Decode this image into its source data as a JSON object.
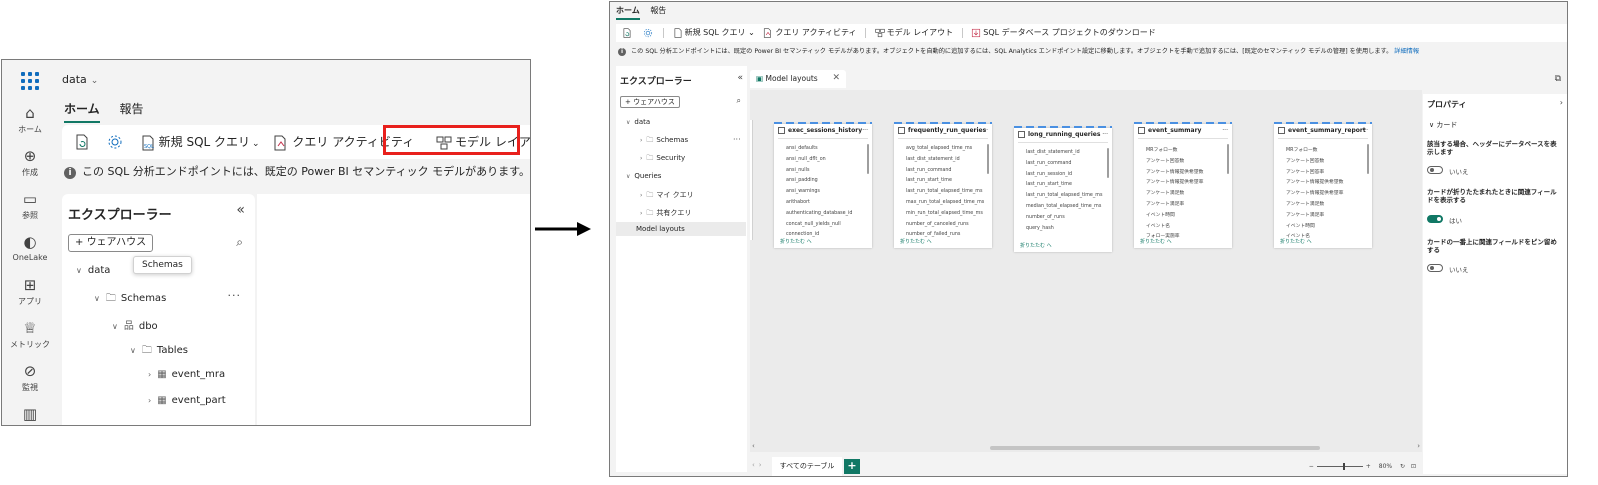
{
  "left": {
    "workspace_name": "data",
    "rail": [
      {
        "label": "ホーム",
        "icon": "home-icon"
      },
      {
        "label": "作成",
        "icon": "create-icon"
      },
      {
        "label": "参照",
        "icon": "browse-icon"
      },
      {
        "label": "OneLake",
        "icon": "onelake-icon"
      },
      {
        "label": "アプリ",
        "icon": "apps-icon"
      },
      {
        "label": "メトリック",
        "icon": "metrics-icon"
      },
      {
        "label": "監視",
        "icon": "monitor-icon"
      }
    ],
    "tabs": [
      "ホーム",
      "報告"
    ],
    "ribbon": {
      "new_sql_query": "新規 SQL クエリ",
      "query_activity": "クエリ アクティビティ",
      "model_layouts": "モデル レイアウト"
    },
    "info_text": "この SQL 分析エンドポイントには、既定の Power BI セマンティック モデルがあります。オブジェクトを自",
    "explorer": {
      "title": "エクスプローラー",
      "add_warehouse": "ウェアハウス",
      "tooltip": "Schemas",
      "tree": [
        {
          "label": "data",
          "level": 0,
          "caret": "down"
        },
        {
          "label": "Schemas",
          "level": 1,
          "caret": "down",
          "icon": "folder"
        },
        {
          "label": "dbo",
          "level": 2,
          "caret": "down",
          "icon": "schema"
        },
        {
          "label": "Tables",
          "level": 3,
          "caret": "down",
          "icon": "folder"
        },
        {
          "label": "event_mra",
          "level": 4,
          "caret": "right",
          "icon": "table"
        },
        {
          "label": "event_part",
          "level": 4,
          "caret": "right",
          "icon": "table"
        }
      ]
    }
  },
  "right": {
    "tabs": [
      "ホーム",
      "報告"
    ],
    "ribbon": {
      "new_sql_query": "新規 SQL クエリ",
      "query_activity": "クエリ アクティビティ",
      "model_layouts": "モデル レイアウト",
      "download": "SQL データベース プロジェクトのダウンロード"
    },
    "info_text": "この SQL 分析エンドポイントには、既定の Power BI セマンティック モデルがあります。オブジェクトを自動的に追加するには、SQL Analytics エンドポイント設定に移動します。オブジェクトを手動で追加するには、[既定のセマンティック モデルの管理] を使用します。",
    "info_link": "詳細情報",
    "explorer": {
      "title": "エクスプローラー",
      "add_warehouse": "ウェアハウス",
      "tree": [
        {
          "label": "data",
          "caret": "down"
        },
        {
          "label": "Schemas",
          "caret": "right",
          "icon": "folder"
        },
        {
          "label": "Security",
          "caret": "right",
          "icon": "folder"
        },
        {
          "label": "Queries",
          "caret": "down"
        },
        {
          "label": "マイ クエリ",
          "caret": "right",
          "icon": "folder"
        },
        {
          "label": "共有クエリ",
          "caret": "right",
          "icon": "folder"
        },
        {
          "label": "Model layouts",
          "selected": true
        }
      ]
    },
    "doc_tab": "Model layouts",
    "cards": [
      {
        "title": "exec_sessions_history",
        "fields": [
          "ansi_defaults",
          "ansi_null_dflt_on",
          "ansi_nulls",
          "ansi_padding",
          "ansi_warnings",
          "arithabort",
          "authenticating_database_id",
          "concat_null_yields_null",
          "connection_id"
        ],
        "footer": "折りたたむ へ"
      },
      {
        "title": "frequently_run_queries",
        "fields": [
          "avg_total_elapsed_time_ms",
          "last_dist_statement_id",
          "last_run_command",
          "last_run_start_time",
          "last_run_total_elapsed_time_ms",
          "max_run_total_elapsed_time_ms",
          "min_run_total_elapsed_time_ms",
          "number_of_canceled_runs",
          "number_of_failed_runs"
        ],
        "footer": "折りたたむ へ"
      },
      {
        "title": "long_running_queries",
        "fields": [
          "last_dist_statement_id",
          "last_run_command",
          "last_run_session_id",
          "last_run_start_time",
          "last_run_total_elapsed_time_ms",
          "median_total_elapsed_time_ms",
          "number_of_runs",
          "query_hash"
        ],
        "footer": "折りたたむ へ"
      },
      {
        "title": "event_summary",
        "fields": [
          "MRフォロー数",
          "アンケート回答数",
          "アンケート情報提供希望数",
          "アンケート情報提供希望率",
          "アンケート満足数",
          "アンケート満足率",
          "イベント時間",
          "イベント名",
          "フォロー実施率"
        ],
        "footer": "折りたたむ へ"
      },
      {
        "title": "event_summary_report",
        "fields": [
          "MRフォロー数",
          "アンケート回答数",
          "アンケート回答率",
          "アンケート情報提供希望数",
          "アンケート情報提供希望率",
          "アンケート満足数",
          "アンケート満足率",
          "イベント時間",
          "イベント名"
        ],
        "footer": "折りたたむ へ"
      }
    ],
    "properties": {
      "title": "プロパティ",
      "section": "カード",
      "settings": [
        {
          "label": "該当する場合、ヘッダーにデータベースを表示します",
          "value": "いいえ",
          "on": false
        },
        {
          "label": "カードが折りたたまれたときに関連フィールドを表示する",
          "value": "はい",
          "on": true
        },
        {
          "label": "カードの一番上に関連フィールドをピン留めする",
          "value": "いいえ",
          "on": false
        }
      ]
    },
    "bottom_tab": "すべてのテーブル",
    "zoom": "80%"
  },
  "colors": {
    "accent": "#117865",
    "highlight": "#e8201c",
    "link": "#0f6cbd"
  }
}
